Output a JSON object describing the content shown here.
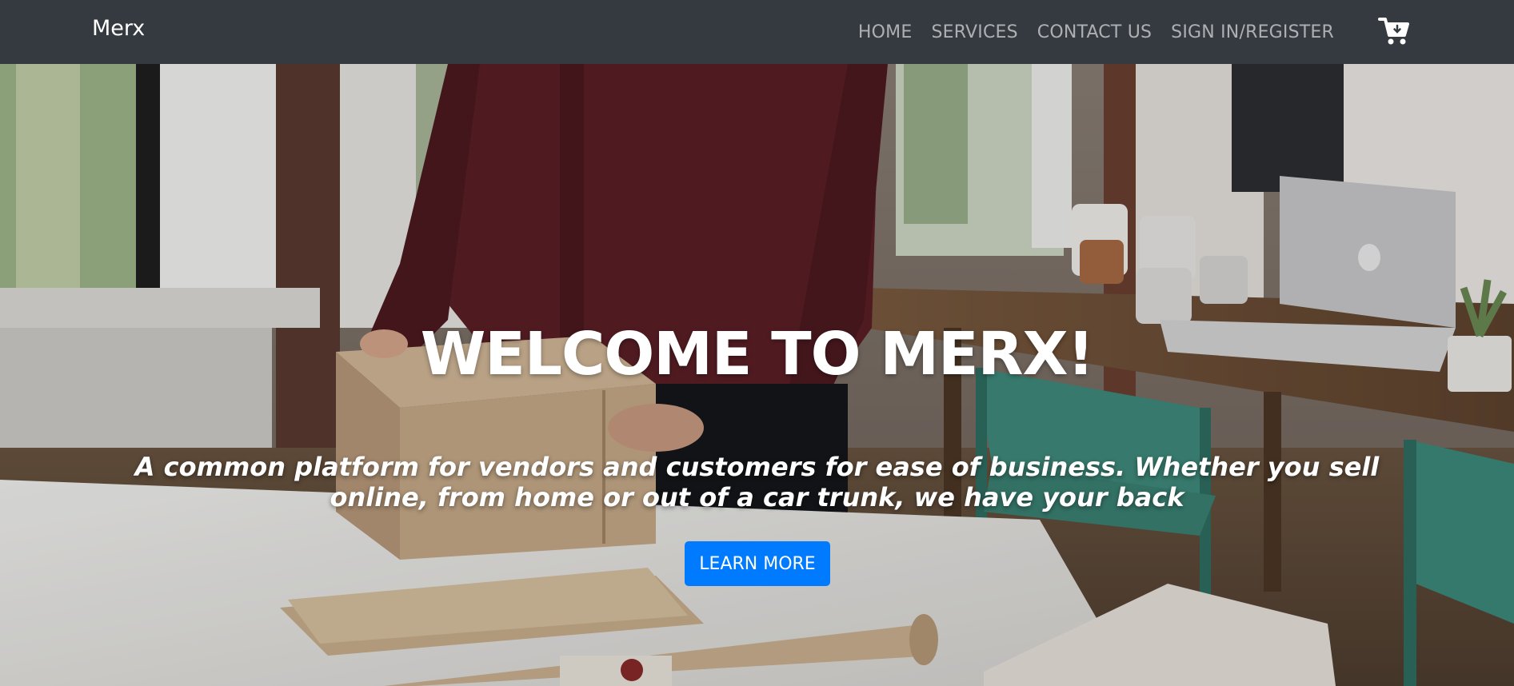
{
  "navbar": {
    "brand": "Merx",
    "links": [
      {
        "label": "HOME"
      },
      {
        "label": "SERVICES"
      },
      {
        "label": "CONTACT US"
      },
      {
        "label": "SIGN IN/REGISTER"
      }
    ],
    "cart_icon": "shopping-cart-icon"
  },
  "hero": {
    "title": "WELCOME TO MERX!",
    "subtitle": "A common platform for vendors and customers for ease of business. Whether you sell online, from home or out of a car trunk, we have your back",
    "button_label": "LEARN MORE"
  },
  "colors": {
    "navbar_bg": "#343a40",
    "button_bg": "#007bff",
    "text": "#ffffff"
  }
}
